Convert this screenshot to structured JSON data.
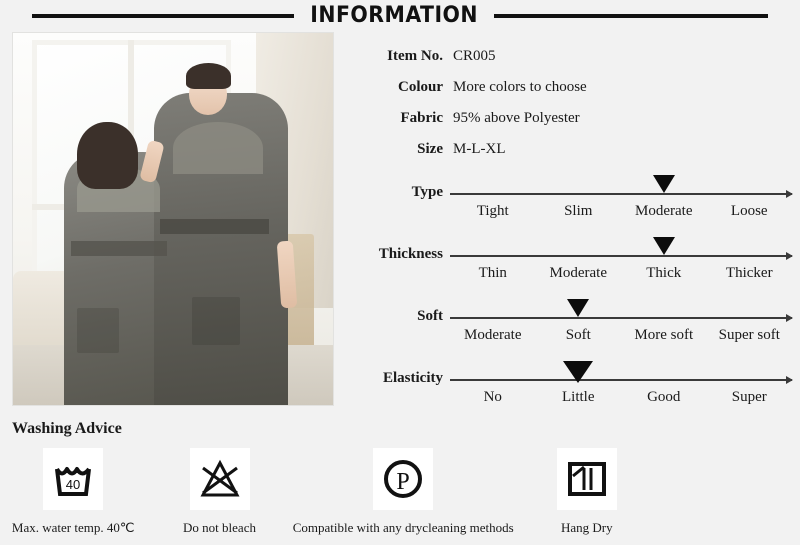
{
  "header": {
    "title": "INFORMATION"
  },
  "photo": {
    "alt": "couple-wearing-gray-flannel-bathrobes"
  },
  "specs": [
    {
      "label": "Item No.",
      "value": "CR005"
    },
    {
      "label": "Colour",
      "value": "More colors to choose"
    },
    {
      "label": "Fabric",
      "value": "95% above Polyester"
    },
    {
      "label": "Size",
      "value": "M-L-XL"
    }
  ],
  "scales": [
    {
      "label": "Type",
      "options": [
        "Tight",
        "Slim",
        "Moderate",
        "Loose"
      ],
      "selected": "Moderate",
      "selected_index": 2,
      "marker_percent": 62.5,
      "marker_wide": false
    },
    {
      "label": "Thickness",
      "options": [
        "Thin",
        "Moderate",
        "Thick",
        "Thicker"
      ],
      "selected": "Thick",
      "selected_index": 2,
      "marker_percent": 62.5,
      "marker_wide": false
    },
    {
      "label": "Soft",
      "options": [
        "Moderate",
        "Soft",
        "More soft",
        "Super soft"
      ],
      "selected": "Soft",
      "selected_index": 1,
      "marker_percent": 37.5,
      "marker_wide": false
    },
    {
      "label": "Elasticity",
      "options": [
        "No",
        "Little",
        "Good",
        "Super"
      ],
      "selected": "Little",
      "selected_index": 1,
      "marker_percent": 37.5,
      "marker_wide": true
    }
  ],
  "washing": {
    "title": "Washing Advice",
    "items": [
      {
        "icon": "wash-tub-40-icon",
        "temperature": "40",
        "caption": "Max. water temp. 40℃"
      },
      {
        "icon": "do-not-bleach-icon",
        "caption": "Do not bleach"
      },
      {
        "icon": "drycleaning-p-icon",
        "letter": "P",
        "caption": "Compatible with any drycleaning methods"
      },
      {
        "icon": "hang-dry-icon",
        "caption": "Hang Dry"
      }
    ]
  },
  "colors": {
    "background": "#f2f2f2",
    "ink": "#111111",
    "rule": "#111111",
    "marker": "#0c0c0c",
    "tile": "#ffffff"
  }
}
